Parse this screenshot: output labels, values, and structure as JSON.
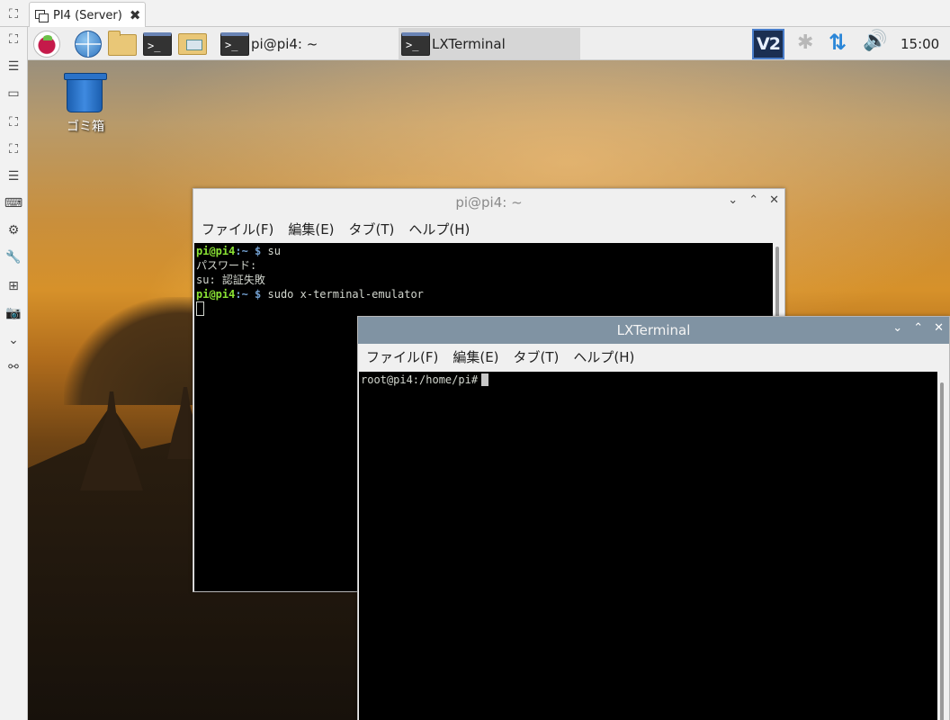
{
  "vnc": {
    "tab_title": "PI4 (Server)",
    "tab_close": "✖",
    "sidebar_icons": [
      "scale-icon",
      "fullscreen-icon",
      "menu-icon",
      "window-icon",
      "crop-icon",
      "expand-icon",
      "list-icon",
      "keyboard-icon",
      "settings-icon",
      "tools-icon",
      "new-tab-icon",
      "screenshot-icon",
      "collapse-icon",
      "disconnect-icon"
    ]
  },
  "taskbar": {
    "tasks": [
      {
        "label": "pi@pi4: ~",
        "icon": "terminal-icon"
      },
      {
        "label": "LXTerminal",
        "icon": "terminal-icon"
      }
    ],
    "launcher_prompt_glyph": ">_",
    "tray": {
      "vnc_label": "V2",
      "bluetooth": "✱",
      "network": "⇅",
      "volume": "🔊",
      "clock": "15:00"
    }
  },
  "desktop": {
    "trash_label": "ゴミ箱"
  },
  "windows": {
    "back": {
      "title": "pi@pi4: ~",
      "menu": [
        "ファイル(F)",
        "編集(E)",
        "タブ(T)",
        "ヘルプ(H)"
      ],
      "lines": [
        {
          "user": "pi@pi4",
          "path": ":~",
          "sym": "$",
          "cmd": " su"
        },
        {
          "text": "パスワード:"
        },
        {
          "text": "su: 認証失敗"
        },
        {
          "user": "pi@pi4",
          "path": ":~",
          "sym": "$",
          "cmd": " sudo x-terminal-emulator"
        }
      ]
    },
    "front": {
      "title": "LXTerminal",
      "menu": [
        "ファイル(F)",
        "編集(E)",
        "タブ(T)",
        "ヘルプ(H)"
      ],
      "prompt": "root@pi4:/home/pi#"
    },
    "controls": {
      "minimize": "⌄",
      "maximize": "⌃",
      "close": "✕"
    }
  }
}
